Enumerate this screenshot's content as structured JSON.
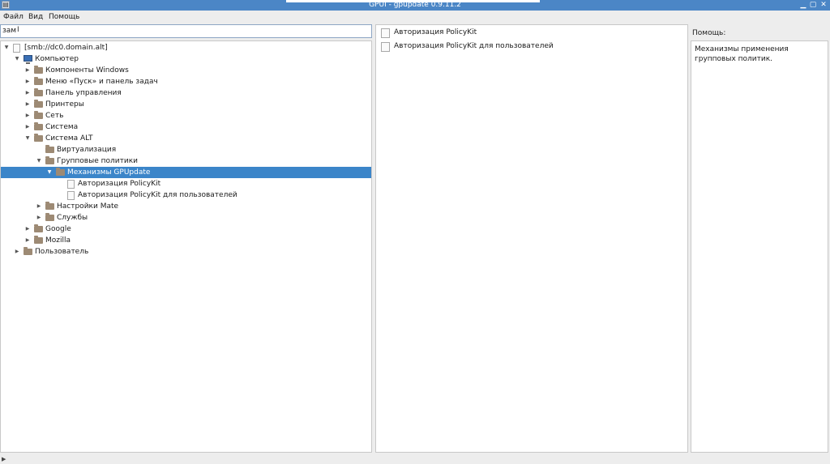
{
  "window": {
    "title": "GPUI - gpupdate 0.9.11.2",
    "app_icon": "gpui-app-icon"
  },
  "menubar": {
    "file": "Файл",
    "view": "Вид",
    "help": "Помощь"
  },
  "search": {
    "value": "зам"
  },
  "tree": {
    "root": "[smb://dc0.domain.alt]",
    "computer": "Компьютер",
    "windows_components": "Компоненты Windows",
    "start_menu": "Меню «Пуск» и панель задач",
    "control_panel": "Панель управления",
    "printers": "Принтеры",
    "network": "Сеть",
    "system": "Система",
    "system_alt": "Система ALT",
    "virtualization": "Виртуализация",
    "group_policies": "Групповые политики",
    "gpupdate_mechanisms": "Механизмы GPUpdate",
    "policykit_auth": "Авторизация PolicyKit",
    "policykit_auth_users": "Авторизация PolicyKit для пользователей",
    "mate_settings": "Настройки Mate",
    "services": "Службы",
    "google": "Google",
    "mozilla": "Mozilla",
    "user": "Пользователь"
  },
  "list": {
    "items": [
      "Авторизация PolicyKit",
      "Авторизация PolicyKit для пользователей"
    ]
  },
  "help": {
    "title": "Помощь:",
    "text": "Механизмы применения групповых политик."
  },
  "colors": {
    "titlebar": "#4b86c6",
    "selection": "#3b85c9",
    "folder": "#9d8a74"
  }
}
